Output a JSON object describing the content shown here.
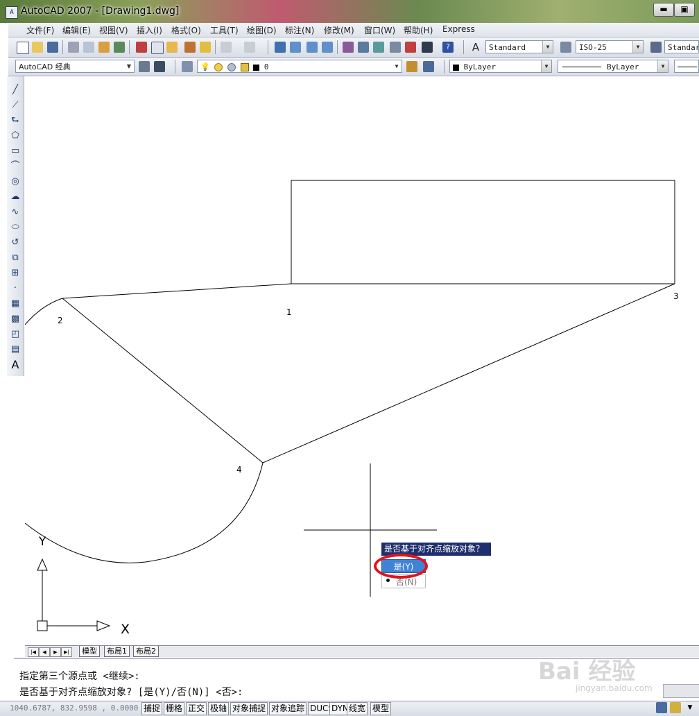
{
  "window": {
    "title": "AutoCAD 2007 - [Drawing1.dwg]",
    "minimize": "▬",
    "restore": "▣"
  },
  "menu": {
    "items": [
      "文件(F)",
      "编辑(E)",
      "视图(V)",
      "插入(I)",
      "格式(O)",
      "工具(T)",
      "绘图(D)",
      "标注(N)",
      "修改(M)",
      "窗口(W)",
      "帮助(H)",
      "Express"
    ]
  },
  "toolbar1": {
    "text_style": "Standard",
    "dim_style": "ISO-25",
    "table_style": "Standard"
  },
  "toolbar2": {
    "workspace": "AutoCAD 经典",
    "layer": "0",
    "color": "ByLayer",
    "linetype": "ByLayer"
  },
  "drawing": {
    "point_labels": [
      "1",
      "2",
      "3",
      "4"
    ],
    "ucs_y": "Y",
    "ucs_x": "X"
  },
  "tabs": [
    "模型",
    "布局1",
    "布局2"
  ],
  "prompt": {
    "title": "是否基于对齐点缩放对象？",
    "yes": "是(Y)",
    "no": "否(N)"
  },
  "command": {
    "line1": "指定第三个源点或 <继续>:",
    "line2": "是否基于对齐点缩放对象? [是(Y)/否(N)] <否>:"
  },
  "status": {
    "coords": "1040.6787, 832.9598 , 0.0000",
    "buttons": [
      "捕捉",
      "栅格",
      "正交",
      "极轴",
      "对象捕捉",
      "对象追踪",
      "DUCS",
      "DYN",
      "线宽",
      "模型"
    ]
  },
  "watermark": {
    "text": "Bai 经验",
    "url": "jingyan.baidu.com"
  },
  "colors": {
    "accent": "#3f83d6",
    "prompt_title": "#1f2f6e",
    "highlight": "#e0141e"
  }
}
